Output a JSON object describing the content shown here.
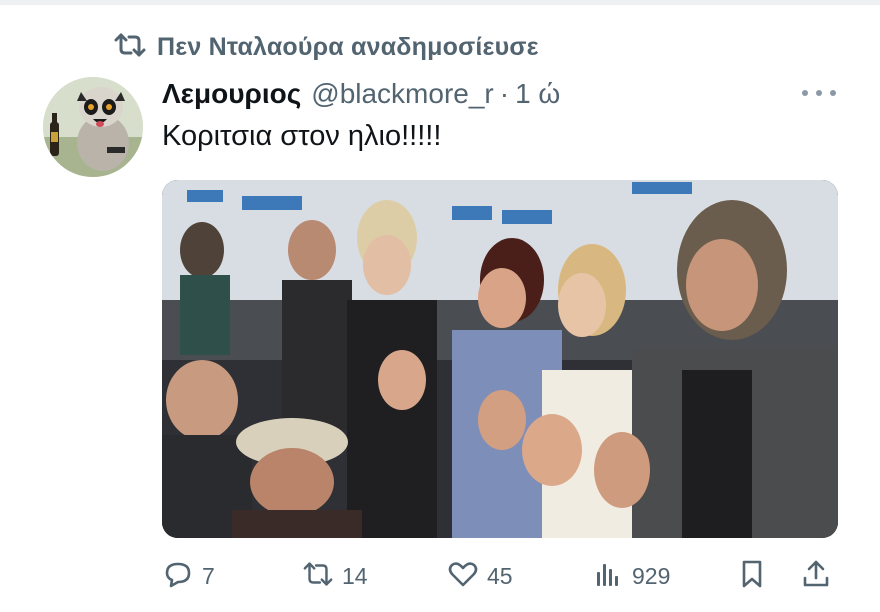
{
  "retweet": {
    "text": "Πεν Νταλαούρα αναδημοσίευσε",
    "icon": "retweet-icon"
  },
  "tweet": {
    "display_name": "Λεμουριος",
    "handle": "@blackmore_r",
    "separator": "·",
    "time": "1 ώ",
    "text": "Κοριτσια στον ηλιο!!!!!"
  },
  "actions": {
    "replies": "7",
    "retweets": "14",
    "likes": "45",
    "views": "929"
  },
  "colors": {
    "secondary_text": "#536471",
    "primary_text": "#0f1419",
    "background": "#ffffff"
  }
}
